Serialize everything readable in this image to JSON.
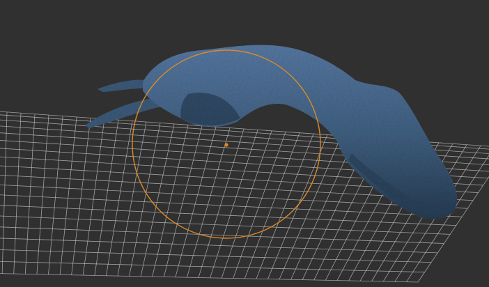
{
  "viewport": {
    "background_color": "#303030",
    "grid_color": "#bdbdbd",
    "model_color": "#3f5f80",
    "model_shadow_color": "#263a50",
    "brush_cursor_color": "#d98a2b",
    "pivot_color": "#e08a1e"
  },
  "icons": {
    "brush": "brush-cursor-circle-icon",
    "pivot": "pivot-point-icon"
  }
}
